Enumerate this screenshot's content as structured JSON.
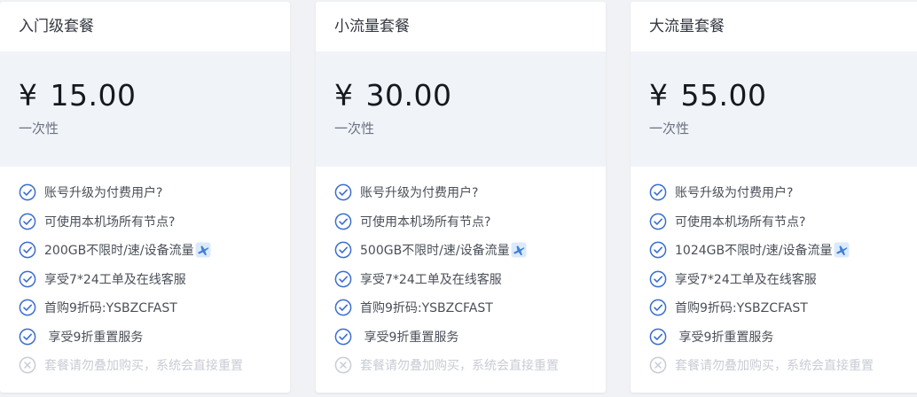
{
  "plans": [
    {
      "title": "入门级套餐",
      "price": "15.00",
      "currency": "¥",
      "period": "一次性",
      "features": [
        "账号升级为付费用户?",
        "可使用本机场所有节点?",
        "200GB不限时/速/设备流量",
        "享受7*24工单及在线客服",
        "首购9折码:YSBZCFAST",
        " 享受9折重置服务"
      ],
      "disabled_feature": "套餐请勿叠加购买，系统会直接重置"
    },
    {
      "title": "小流量套餐",
      "price": "30.00",
      "currency": "¥",
      "period": "一次性",
      "features": [
        "账号升级为付费用户?",
        "可使用本机场所有节点?",
        "500GB不限时/速/设备流量",
        "享受7*24工单及在线客服",
        "首购9折码:YSBZCFAST",
        " 享受9折重置服务"
      ],
      "disabled_feature": "套餐请勿叠加购买，系统会直接重置"
    },
    {
      "title": "大流量套餐",
      "price": "55.00",
      "currency": "¥",
      "period": "一次性",
      "features": [
        "账号升级为付费用户?",
        "可使用本机场所有节点?",
        "1024GB不限时/速/设备流量",
        "享受7*24工单及在线客服",
        "首购9折码:YSBZCFAST",
        " 享受9折重置服务"
      ],
      "disabled_feature": "套餐请勿叠加购买，系统会直接重置"
    }
  ],
  "colors": {
    "check": "#3a6ed0",
    "disabled": "#c8ccd4",
    "price_bg": "#f0f3f8",
    "page_bg": "#f0f2f5"
  },
  "icons": {
    "feature_ok": "check-circle-icon",
    "feature_off": "x-circle-icon",
    "traffic": "airplane-icon"
  }
}
